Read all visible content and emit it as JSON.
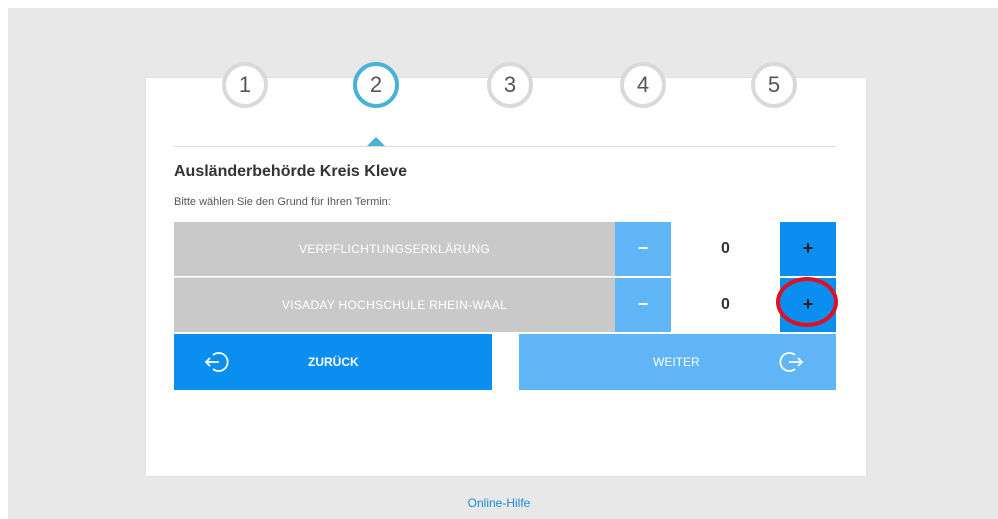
{
  "steps": [
    "1",
    "2",
    "3",
    "4",
    "5"
  ],
  "active_step": "2",
  "section": {
    "title": "Ausländerbehörde Kreis Kleve",
    "subtitle": "Bitte wählen Sie den Grund für Ihren Termin:"
  },
  "reasons": [
    {
      "label": "VERPFLICHTUNGSERKLÄRUNG",
      "minus": "−",
      "quantity": "0",
      "plus": "+"
    },
    {
      "label": "VISADAY HOCHSCHULE RHEIN-WAAL",
      "minus": "−",
      "quantity": "0",
      "plus": "+"
    }
  ],
  "buttons": {
    "back_label": "ZURÜCK",
    "next_label": "WEITER"
  },
  "footer": {
    "help_link": "Online-Hilfe"
  },
  "colors": {
    "accent": "#0a8ff0",
    "accent_light": "#5fb5f5",
    "active_step_ring": "#4ab1d8",
    "row_gray": "#c9c9c9",
    "highlight_circle": "#e0101e"
  },
  "icons": {
    "back": "arrow-left-circle-icon",
    "next": "arrow-right-circle-icon"
  }
}
